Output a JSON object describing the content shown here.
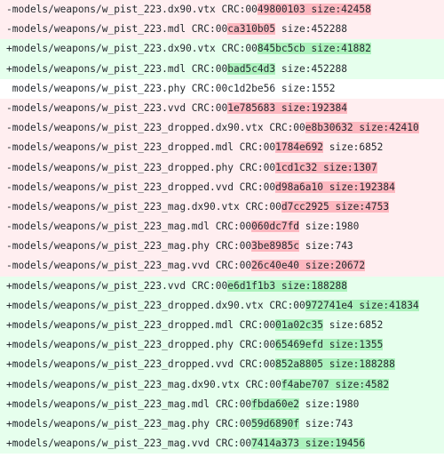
{
  "colors": {
    "deletion_bg": "#ffeef0",
    "deletion_highlight": "#fdb8c0",
    "addition_bg": "#e6ffed",
    "addition_highlight": "#acf2bd",
    "context_bg": "#ffffff"
  },
  "lines": [
    {
      "type": "del",
      "pre": "-models/weapons/w_pist_223.dx90.vtx CRC:00",
      "hl": "49800103 size:42458",
      "post": ""
    },
    {
      "type": "del",
      "pre": "-models/weapons/w_pist_223.mdl CRC:00",
      "hl": "ca310b05",
      "post": " size:452288"
    },
    {
      "type": "add",
      "pre": "+models/weapons/w_pist_223.dx90.vtx CRC:00",
      "hl": "845bc5cb size:41882",
      "post": ""
    },
    {
      "type": "add",
      "pre": "+models/weapons/w_pist_223.mdl CRC:00",
      "hl": "bad5c4d3",
      "post": " size:452288"
    },
    {
      "type": "ctx",
      "pre": " models/weapons/w_pist_223.phy CRC:00c1d2be56 size:1552",
      "hl": "",
      "post": ""
    },
    {
      "type": "del",
      "pre": "-models/weapons/w_pist_223.vvd CRC:00",
      "hl": "1e785683 size:192384",
      "post": ""
    },
    {
      "type": "del",
      "pre": "-models/weapons/w_pist_223_dropped.dx90.vtx CRC:00",
      "hl": "e8b30632 size:42410",
      "post": ""
    },
    {
      "type": "del",
      "pre": "-models/weapons/w_pist_223_dropped.mdl CRC:00",
      "hl": "1784e692",
      "post": " size:6852"
    },
    {
      "type": "del",
      "pre": "-models/weapons/w_pist_223_dropped.phy CRC:00",
      "hl": "1cd1c32 size:1307",
      "post": ""
    },
    {
      "type": "del",
      "pre": "-models/weapons/w_pist_223_dropped.vvd CRC:00",
      "hl": "d98a6a10 size:192384",
      "post": ""
    },
    {
      "type": "del",
      "pre": "-models/weapons/w_pist_223_mag.dx90.vtx CRC:00",
      "hl": "d7cc2925 size:4753",
      "post": ""
    },
    {
      "type": "del",
      "pre": "-models/weapons/w_pist_223_mag.mdl CRC:00",
      "hl": "060dc7fd",
      "post": " size:1980"
    },
    {
      "type": "del",
      "pre": "-models/weapons/w_pist_223_mag.phy CRC:00",
      "hl": "3be8985c",
      "post": " size:743"
    },
    {
      "type": "del",
      "pre": "-models/weapons/w_pist_223_mag.vvd CRC:00",
      "hl": "26c40e40 size:20672",
      "post": ""
    },
    {
      "type": "add",
      "pre": "+models/weapons/w_pist_223.vvd CRC:00",
      "hl": "e6d1f1b3 size:188288",
      "post": ""
    },
    {
      "type": "add",
      "pre": "+models/weapons/w_pist_223_dropped.dx90.vtx CRC:00",
      "hl": "972741e4 size:41834",
      "post": ""
    },
    {
      "type": "add",
      "pre": "+models/weapons/w_pist_223_dropped.mdl CRC:00",
      "hl": "01a02c35",
      "post": " size:6852"
    },
    {
      "type": "add",
      "pre": "+models/weapons/w_pist_223_dropped.phy CRC:00",
      "hl": "65469efd size:1355",
      "post": ""
    },
    {
      "type": "add",
      "pre": "+models/weapons/w_pist_223_dropped.vvd CRC:00",
      "hl": "852a8805 size:188288",
      "post": ""
    },
    {
      "type": "add",
      "pre": "+models/weapons/w_pist_223_mag.dx90.vtx CRC:00",
      "hl": "f4abe707 size:4582",
      "post": ""
    },
    {
      "type": "add",
      "pre": "+models/weapons/w_pist_223_mag.mdl CRC:00",
      "hl": "fbda60e2",
      "post": " size:1980"
    },
    {
      "type": "add",
      "pre": "+models/weapons/w_pist_223_mag.phy CRC:00",
      "hl": "59d6890f",
      "post": " size:743"
    },
    {
      "type": "add",
      "pre": "+models/weapons/w_pist_223_mag.vvd CRC:00",
      "hl": "7414a373 size:19456",
      "post": ""
    }
  ]
}
